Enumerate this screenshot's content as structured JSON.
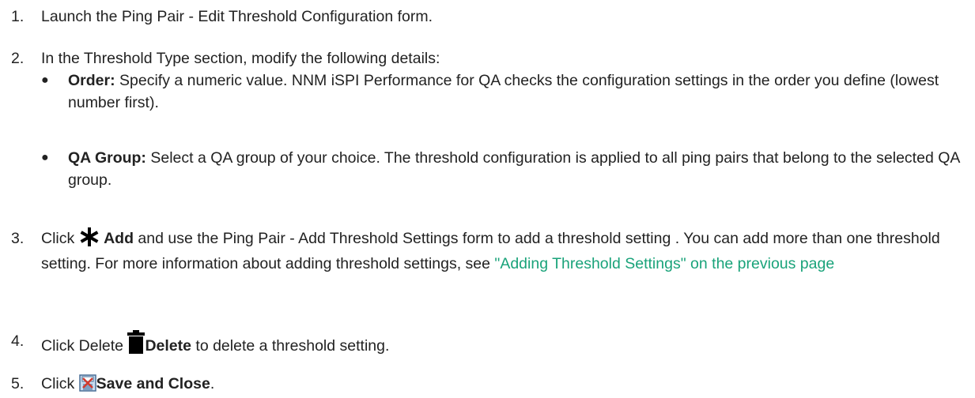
{
  "steps": [
    {
      "num": "1.",
      "text": "Launch the Ping Pair - Edit Threshold Configuration form."
    },
    {
      "num": "2.",
      "text": "In the Threshold Type section, modify the following details:",
      "bullets": [
        {
          "label": "Order:",
          "text": " Specify a numeric value. NNM iSPI Performance for QA checks the configuration settings in the order you define (lowest number first)."
        },
        {
          "label": "QA Group:",
          "text": " Select a QA group of your choice. The threshold configuration is applied to all ping pairs that belong to the selected QA group."
        }
      ]
    },
    {
      "num": "3.",
      "pre": "Click ",
      "bold": "Add",
      "mid": " and use the Ping Pair - Add Threshold Settings form to add a threshold setting . You can add more than one threshold setting. For more information about adding threshold settings, see ",
      "link": "\"Adding Threshold Settings\" on the previous page",
      "icon": "asterisk-icon"
    },
    {
      "num": "4.",
      "pre": "Click Delete ",
      "bold": "Delete",
      "post": " to delete a threshold setting.",
      "icon": "trash-icon"
    },
    {
      "num": "5.",
      "pre": "Click ",
      "bold": "Save and Close",
      "post": ".",
      "icon": "save-close-icon"
    }
  ]
}
